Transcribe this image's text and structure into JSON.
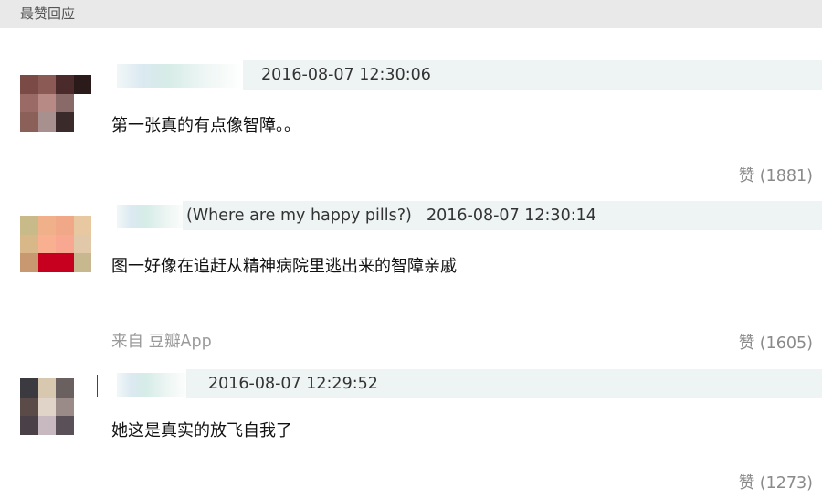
{
  "section": {
    "title": "最赞回应"
  },
  "comments": [
    {
      "author_extra": "",
      "timestamp": "2016-08-07 12:30:06",
      "text": "第一张真的有点像智障。。",
      "source": "",
      "like_label": "赞 (1881)",
      "avatar_colors": [
        "#7a4a47",
        "#8b5a55",
        "#4a2a2a",
        "#2a1a1a",
        "#9a6a66",
        "#b88a86",
        "#8a6a68",
        "#ffffff",
        "#8a6058",
        "#a8908e",
        "#3a2a2a",
        "#ffffff"
      ]
    },
    {
      "author_extra": "(Where are my happy pills?)",
      "timestamp": "2016-08-07 12:30:14",
      "text": "图一好像在追赶从精神病院里逃出来的智障亲戚",
      "source": "",
      "like_label": "赞 (1605)",
      "avatar_colors": [
        "#c9ba8a",
        "#f0b08a",
        "#f0a888",
        "#e8c8a0",
        "#d8b888",
        "#f8b090",
        "#f8a890",
        "#e0c8a8",
        "#c89870",
        "#c80020",
        "#c80020",
        "#c8b890"
      ]
    },
    {
      "author_extra": "",
      "timestamp": "2016-08-07 12:29:52",
      "text": "她这是真实的放飞自我了",
      "source": "",
      "like_label": "赞 (1273)",
      "avatar_colors": [
        "#3a3a40",
        "#d8c8b0",
        "#6a6060",
        "#ffffff",
        "#5a4a48",
        "#e0d4c8",
        "#9a8a88",
        "#ffffff",
        "#4a4048",
        "#c8b8c0",
        "#5a5058",
        "#ffffff"
      ]
    }
  ],
  "source_label": "来自 豆瓣App"
}
